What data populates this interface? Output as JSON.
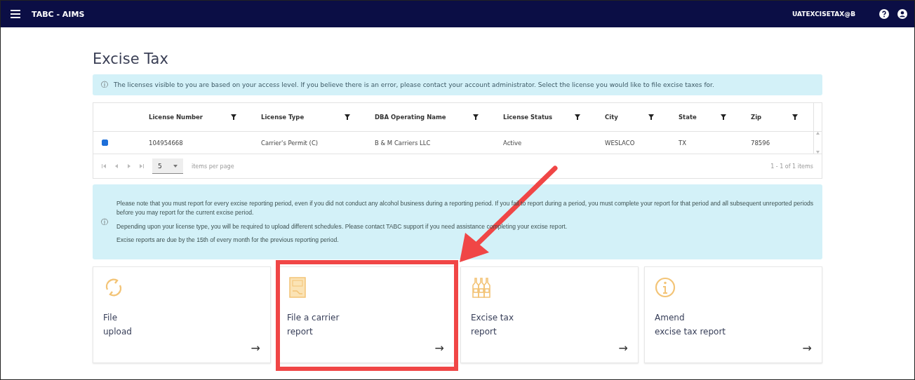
{
  "navbar": {
    "app_title": "TABC - AIMS",
    "user": "UATEXCISETAX@B"
  },
  "page_title": "Excise Tax",
  "access_notice": {
    "icon": "ⓘ",
    "text": "The licenses visible to you are based on your access level. If you believe there is an error, please contact your account administrator. Select the license you would like to file excise taxes for."
  },
  "table": {
    "columns": [
      "License Number",
      "License Type",
      "DBA Operating Name",
      "License Status",
      "City",
      "State",
      "Zip"
    ],
    "rows": [
      {
        "checked": true,
        "cells": [
          "104954668",
          "Carrier's Permit (C)",
          "B & M Carriers LLC",
          "Active",
          "WESLACO",
          "TX",
          "78596"
        ]
      }
    ],
    "pager": {
      "page_size": "5",
      "page_size_label": "items per page",
      "summary": "1 - 1 of 1 items"
    }
  },
  "report_notice": {
    "icon": "ⓘ",
    "paragraphs": [
      "Please note that you must report for every excise reporting period, even if you did not conduct any alcohol business during a reporting period. If you fail to report during a period, you must complete your report for that period and all subsequent unreported periods before you may report for the current excise period.",
      "Depending upon your license type, you will be required to upload different schedules. Please contact TABC support if you need assistance completing your excise report.",
      "Excise reports are due by the 15th of every month for the previous reporting period."
    ]
  },
  "cards": [
    {
      "kind": "upload",
      "title_lines": [
        "File",
        "upload"
      ],
      "arrow": "→",
      "highlighted": false
    },
    {
      "kind": "carrier",
      "title_lines": [
        "File a carrier",
        "report"
      ],
      "arrow": "→",
      "highlighted": true
    },
    {
      "kind": "bottles",
      "title_lines": [
        "Excise tax",
        "report"
      ],
      "arrow": "→",
      "highlighted": false
    },
    {
      "kind": "info",
      "title_lines": [
        "Amend",
        "excise tax report"
      ],
      "arrow": "→",
      "highlighted": false
    }
  ]
}
